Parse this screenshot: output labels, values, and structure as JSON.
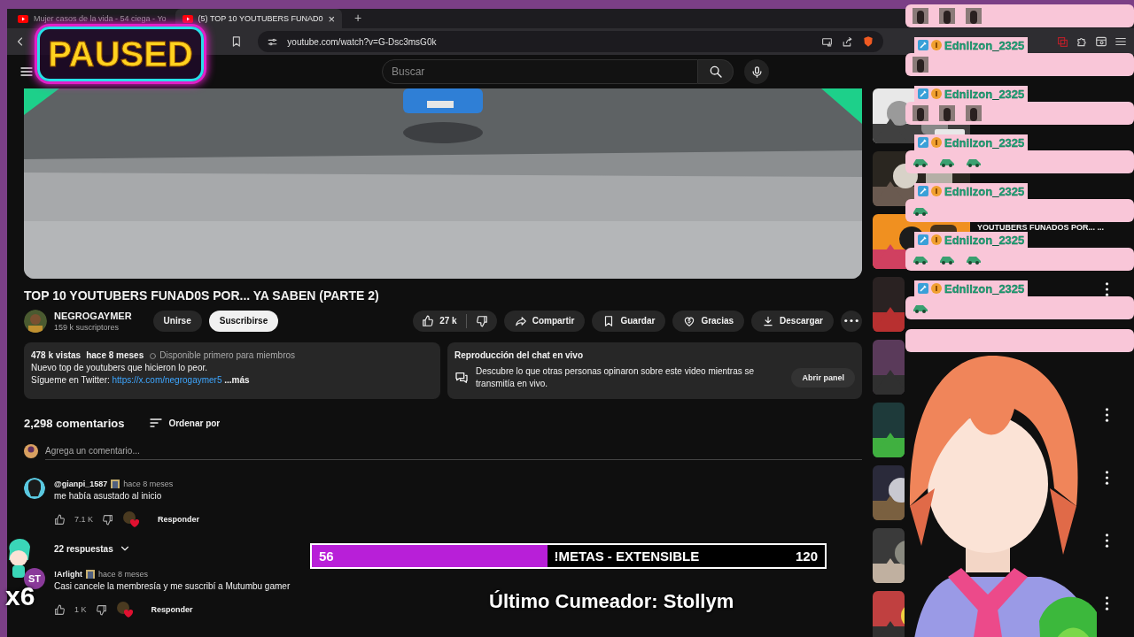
{
  "browser": {
    "tabs": [
      {
        "title": "Mujer casos de la vida - 54 ciega - Yo",
        "selected": false
      },
      {
        "title": "(5) TOP 10 YOUTUBERS FUNAD0",
        "selected": true
      }
    ],
    "close_label": "×",
    "new_tab_label": "+",
    "url": "youtube.com/watch?v=G-Dsc3msG0k"
  },
  "youtube_header": {
    "search_placeholder": "Buscar"
  },
  "video": {
    "title": "TOP 10 YOUTUBERS FUNAD0S POR... YA SABEN (PARTE 2)",
    "channel": {
      "name": "NEGROGAYMER",
      "subscribers": "159 k suscriptores"
    },
    "join_button": "Unirse",
    "subscribe_button": "Suscribirse",
    "likes": "27 k",
    "actions": [
      {
        "kind": "share",
        "label": "Compartir"
      },
      {
        "kind": "save",
        "label": "Guardar"
      },
      {
        "kind": "thanks",
        "label": "Gracias"
      },
      {
        "kind": "download",
        "label": "Descargar"
      }
    ],
    "description": {
      "views": "478 k vistas",
      "date": "hace 8 meses",
      "members_notice": "Disponible primero para miembros",
      "line_1": "Nuevo top de youtubers que hicieron lo peor.",
      "twitter_prefix": "Sígueme en Twitter:",
      "link": "https://x.com/negrogaymer5",
      "more": "...más"
    },
    "live_chat_replay": {
      "title": "Reproducción del chat en vivo",
      "text": "Descubre lo que otras personas opinaron sobre este video mientras se transmitía en vivo.",
      "button": "Abrir panel"
    }
  },
  "comments": {
    "count": "2,298 comentarios",
    "sort_label": "Ordenar por",
    "placeholder": "Agrega un comentario...",
    "items": [
      {
        "author": "@gianpi_1587",
        "time": "hace 8 meses",
        "text": "me había asustado al inicio",
        "likes": "7.1 K",
        "reply_label": "Responder",
        "replies": "22 respuestas"
      },
      {
        "author": "!Arlight",
        "avatar_text": "ST",
        "time": "hace 8 meses",
        "text": "Casi cancele la membresía y me suscribí a Mutumbu gamer",
        "likes": "1 K",
        "reply_label": "Responder"
      }
    ]
  },
  "sidebar": {
    "items": [
      {
        "kind": "video"
      },
      {
        "kind": "video"
      },
      {
        "kind": "video",
        "title": "YOUTUBERS FUNADOS POR... ..."
      },
      {
        "kind": "video",
        "menu_visible": true
      },
      {
        "kind": "video"
      },
      {
        "kind": "video",
        "menu_visible": true
      },
      {
        "kind": "video",
        "menu_visible": true
      },
      {
        "kind": "video",
        "menu_visible": true
      },
      {
        "kind": "video",
        "menu_visible": true
      }
    ]
  },
  "stream_overlay": {
    "paused": "PAUSED",
    "chat": [
      {
        "kind": "message",
        "emotes": [
          {
            "kind": "portrait"
          },
          {
            "kind": "portrait"
          },
          {
            "kind": "portrait"
          }
        ]
      },
      {
        "kind": "message",
        "user": "Ednilzon_2325",
        "emotes": [
          {
            "kind": "portrait"
          }
        ]
      },
      {
        "kind": "message",
        "user": "Ednilzon_2325",
        "emotes": [
          {
            "kind": "portrait"
          },
          {
            "kind": "portrait"
          },
          {
            "kind": "portrait"
          }
        ]
      },
      {
        "kind": "message",
        "user": "Ednilzon_2325",
        "emotes": [
          {
            "kind": "car"
          },
          {
            "kind": "car"
          },
          {
            "kind": "car"
          }
        ]
      },
      {
        "kind": "message",
        "user": "Ednilzon_2325",
        "emotes": [
          {
            "kind": "car"
          }
        ]
      },
      {
        "kind": "message",
        "user": "Ednilzon_2325",
        "emotes": [
          {
            "kind": "car"
          },
          {
            "kind": "car"
          },
          {
            "kind": "car"
          }
        ]
      },
      {
        "kind": "message",
        "user": "Ednilzon_2325",
        "emotes": [
          {
            "kind": "car"
          }
        ]
      },
      {
        "kind": "message"
      }
    ],
    "goal": {
      "current": "56",
      "label": "!METAS",
      "suffix": "- EXTENSIBLE",
      "target": "120",
      "level": 0.46
    },
    "last_cumeador": "Último Cumeador: Stollym",
    "multiplier": "x6"
  }
}
